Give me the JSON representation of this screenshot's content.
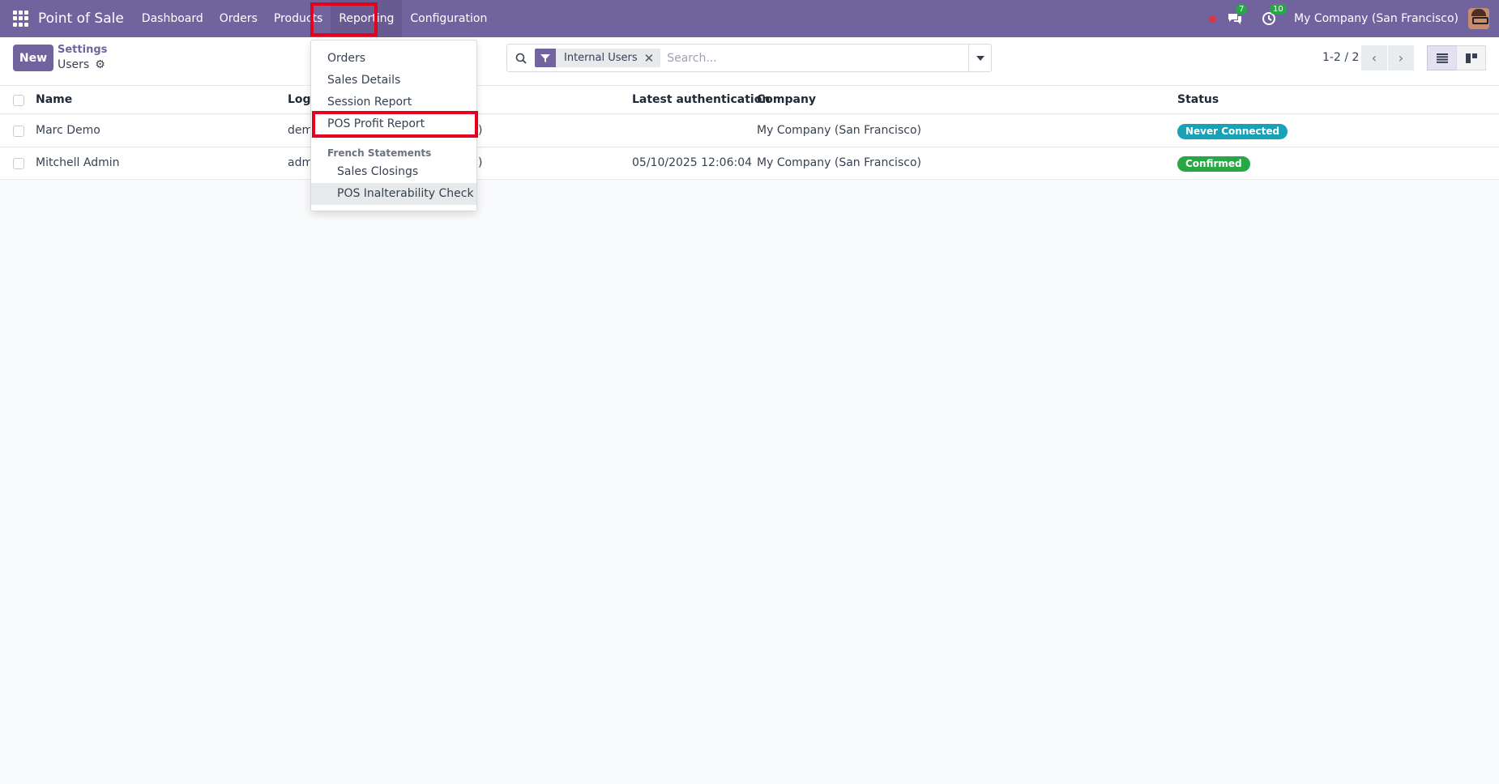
{
  "navbar": {
    "app_name": "Point of Sale",
    "menu": [
      "Dashboard",
      "Orders",
      "Products",
      "Reporting",
      "Configuration"
    ],
    "messages_count": "7",
    "activities_count": "10",
    "company": "My Company (San Francisco)",
    "bg_color": "#71639e"
  },
  "control": {
    "new_label": "New",
    "breadcrumb": "Settings",
    "title": "Users",
    "facet_label": "Internal Users",
    "search_placeholder": "Search...",
    "pager": "1-2 / 2"
  },
  "table": {
    "columns": [
      "Name",
      "Logi",
      "Latest authentication",
      "Company",
      "Status"
    ],
    "rows": [
      {
        "name": "Marc Demo",
        "login": "dem",
        "login_tail": ")",
        "latest_auth": "",
        "company": "My Company (San Francisco)",
        "status": "Never Connected",
        "status_color": "#17a2b8"
      },
      {
        "name": "Mitchell Admin",
        "login": "adm",
        "login_tail": ")",
        "latest_auth": "05/10/2025 12:06:04",
        "company": "My Company (San Francisco)",
        "status": "Confirmed",
        "status_color": "#28a745"
      }
    ]
  },
  "reporting_menu": {
    "items": [
      "Orders",
      "Sales Details",
      "Session Report",
      "POS Profit Report"
    ],
    "section_header": "French Statements",
    "sub_items": [
      "Sales Closings",
      "POS Inalterability Check"
    ]
  }
}
